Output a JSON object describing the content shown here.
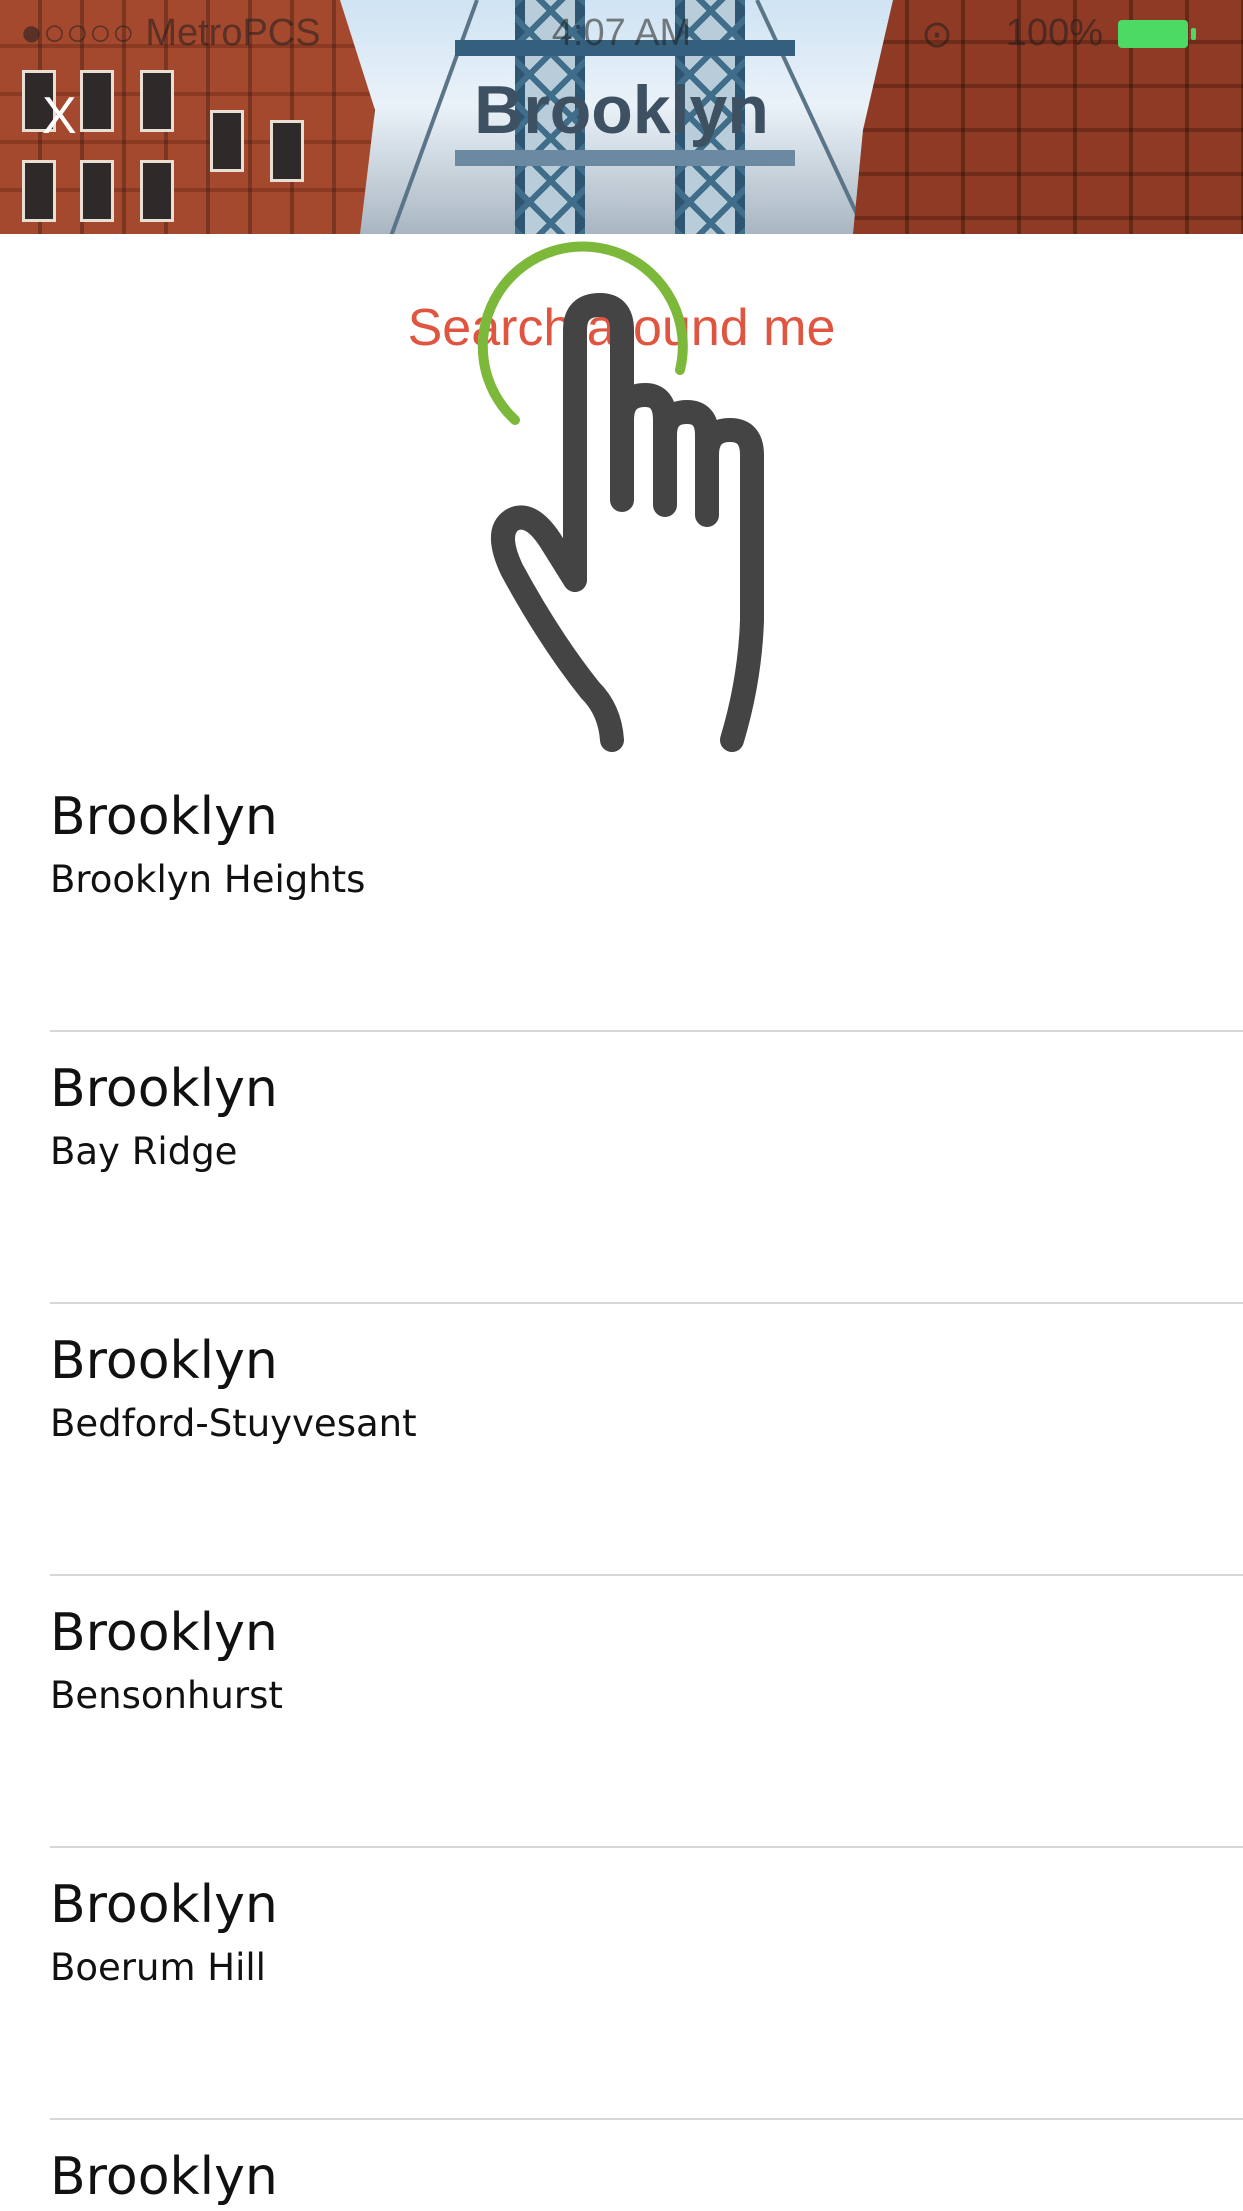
{
  "status_bar": {
    "carrier": "●○○○○ MetroPCS",
    "time": "4:07 AM",
    "battery": "100%"
  },
  "header": {
    "close_label": "X",
    "title": "Brooklyn"
  },
  "search_around_me": "Search around me",
  "colors": {
    "accent_link": "#e0553f",
    "title": "#3e5163",
    "tap_ring": "#7cb83a",
    "hand": "#444444",
    "battery": "#4cd964"
  },
  "list": [
    {
      "city": "Brooklyn",
      "neighborhood": "Brooklyn Heights"
    },
    {
      "city": "Brooklyn",
      "neighborhood": "Bay Ridge"
    },
    {
      "city": "Brooklyn",
      "neighborhood": "Bedford-Stuyvesant"
    },
    {
      "city": "Brooklyn",
      "neighborhood": "Bensonhurst"
    },
    {
      "city": "Brooklyn",
      "neighborhood": "Boerum Hill"
    },
    {
      "city": "Brooklyn",
      "neighborhood": ""
    }
  ]
}
